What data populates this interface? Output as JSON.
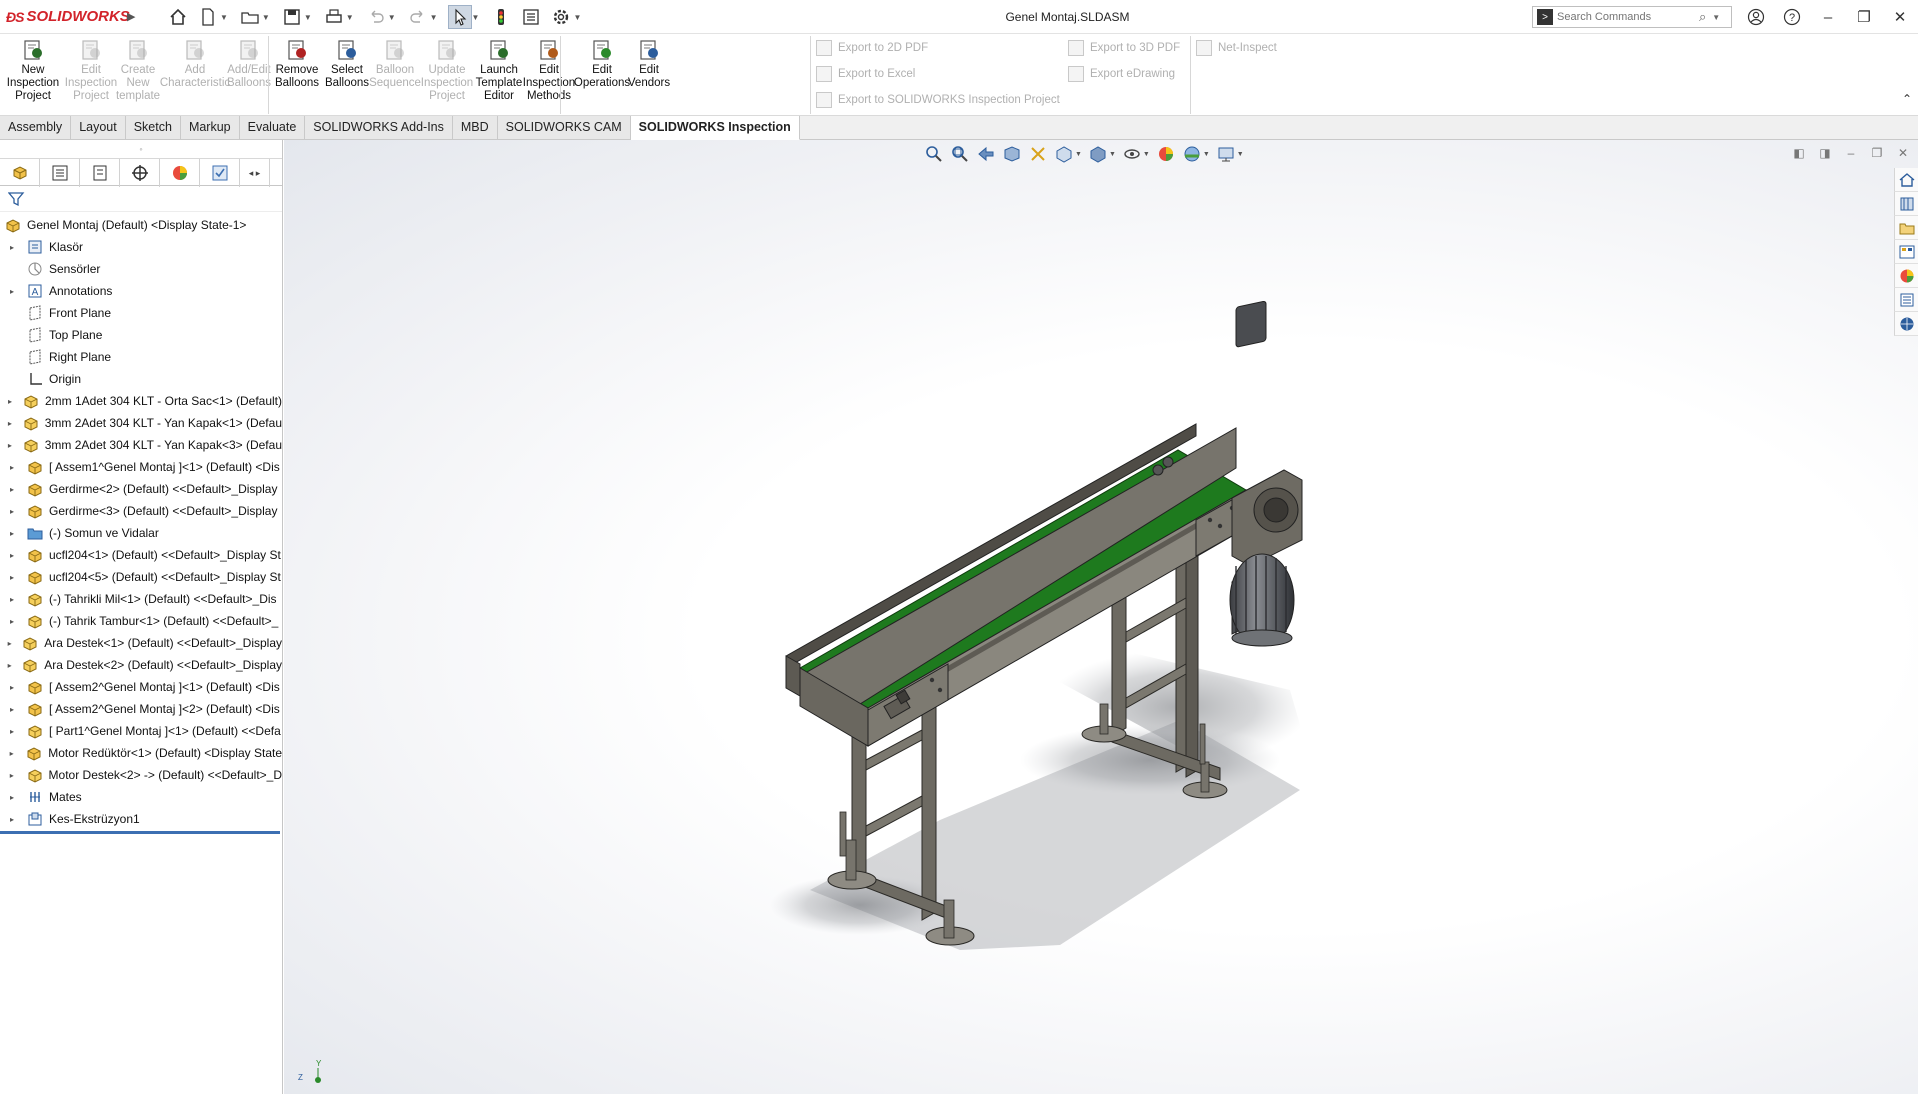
{
  "app": {
    "name": "SOLIDWORKS",
    "document_title": "Genel Montaj.SLDASM"
  },
  "search": {
    "placeholder": "Search Commands"
  },
  "ribbon": {
    "inspection_buttons": [
      {
        "label": "New\nInspection\nProject",
        "enabled": true,
        "icon": "new-inspection-project-icon"
      },
      {
        "label": "Edit\nInspection\nProject",
        "enabled": false,
        "icon": "edit-inspection-project-icon"
      },
      {
        "label": "Create\nNew\ntemplate",
        "enabled": false,
        "icon": "create-template-icon"
      },
      {
        "label": "Add\nCharacteristic",
        "enabled": false,
        "icon": "add-characteristic-icon"
      },
      {
        "label": "Add/Edit\nBalloons",
        "enabled": false,
        "icon": "add-edit-balloons-icon"
      },
      {
        "label": "Remove\nBalloons",
        "enabled": true,
        "icon": "remove-balloons-icon"
      },
      {
        "label": "Select\nBalloons",
        "enabled": true,
        "icon": "select-balloons-icon"
      },
      {
        "label": "Balloon\nSequence",
        "enabled": false,
        "icon": "balloon-sequence-icon"
      },
      {
        "label": "Update\nInspection\nProject",
        "enabled": false,
        "icon": "update-inspection-project-icon"
      },
      {
        "label": "Launch\nTemplate\nEditor",
        "enabled": true,
        "icon": "launch-template-editor-icon"
      },
      {
        "label": "Edit\nInspection\nMethods",
        "enabled": true,
        "icon": "edit-inspection-methods-icon"
      },
      {
        "label": "Edit\nOperations",
        "enabled": true,
        "icon": "edit-operations-icon"
      },
      {
        "label": "Edit\nVendors",
        "enabled": true,
        "icon": "edit-vendors-icon"
      }
    ],
    "export_items": [
      {
        "label": "Export to 2D PDF",
        "enabled": false
      },
      {
        "label": "Export to Excel",
        "enabled": false
      },
      {
        "label": "Export to SOLIDWORKS Inspection Project",
        "enabled": false
      },
      {
        "label": "Export to 3D PDF",
        "enabled": false
      },
      {
        "label": "Export eDrawing",
        "enabled": false
      },
      {
        "label": "Net-Inspect",
        "enabled": false
      }
    ]
  },
  "tabs": [
    {
      "label": "Assembly",
      "active": false
    },
    {
      "label": "Layout",
      "active": false
    },
    {
      "label": "Sketch",
      "active": false
    },
    {
      "label": "Markup",
      "active": false
    },
    {
      "label": "Evaluate",
      "active": false
    },
    {
      "label": "SOLIDWORKS Add-Ins",
      "active": false
    },
    {
      "label": "MBD",
      "active": false
    },
    {
      "label": "SOLIDWORKS CAM",
      "active": false
    },
    {
      "label": "SOLIDWORKS Inspection",
      "active": true
    }
  ],
  "tree": {
    "root": "Genel Montaj  (Default) <Display State-1>",
    "items": [
      {
        "label": "Klasör",
        "icon": "folder-history-icon",
        "expandable": true
      },
      {
        "label": "Sensörler",
        "icon": "sensor-icon",
        "expandable": false
      },
      {
        "label": "Annotations",
        "icon": "annotations-icon",
        "expandable": true
      },
      {
        "label": "Front Plane",
        "icon": "plane-icon",
        "expandable": false
      },
      {
        "label": "Top Plane",
        "icon": "plane-icon",
        "expandable": false
      },
      {
        "label": "Right Plane",
        "icon": "plane-icon",
        "expandable": false
      },
      {
        "label": "Origin",
        "icon": "origin-icon",
        "expandable": false
      },
      {
        "label": "2mm 1Adet 304 KLT - Orta Sac<1> (Default)",
        "icon": "part-icon",
        "expandable": true
      },
      {
        "label": "3mm 2Adet 304 KLT - Yan Kapak<1> (Defau",
        "icon": "part-icon",
        "expandable": true
      },
      {
        "label": "3mm 2Adet 304 KLT - Yan Kapak<3> (Defau",
        "icon": "part-icon",
        "expandable": true
      },
      {
        "label": "[ Assem1^Genel Montaj ]<1> (Default) <Dis",
        "icon": "assembly-icon",
        "expandable": true
      },
      {
        "label": "Gerdirme<2> (Default) <<Default>_Display",
        "icon": "assembly-icon",
        "expandable": true
      },
      {
        "label": "Gerdirme<3> (Default) <<Default>_Display",
        "icon": "assembly-icon",
        "expandable": true
      },
      {
        "label": "(-) Somun ve Vidalar",
        "icon": "folder-icon",
        "expandable": true
      },
      {
        "label": "ucfl204<1> (Default) <<Default>_Display St",
        "icon": "assembly-icon",
        "expandable": true
      },
      {
        "label": "ucfl204<5> (Default) <<Default>_Display St",
        "icon": "assembly-icon",
        "expandable": true
      },
      {
        "label": "(-) Tahrikli Mil<1> (Default) <<Default>_Dis",
        "icon": "part-icon",
        "expandable": true
      },
      {
        "label": "(-) Tahrik Tambur<1> (Default) <<Default>_",
        "icon": "part-icon",
        "expandable": true
      },
      {
        "label": "Ara Destek<1> (Default) <<Default>_Display",
        "icon": "part-icon",
        "expandable": true
      },
      {
        "label": "Ara Destek<2> (Default) <<Default>_Display",
        "icon": "part-icon",
        "expandable": true
      },
      {
        "label": "[ Assem2^Genel Montaj ]<1> (Default) <Dis",
        "icon": "assembly-icon",
        "expandable": true
      },
      {
        "label": "[ Assem2^Genel Montaj ]<2> (Default) <Dis",
        "icon": "assembly-icon",
        "expandable": true
      },
      {
        "label": "[ Part1^Genel Montaj ]<1> (Default) <<Defa",
        "icon": "part-icon",
        "expandable": true
      },
      {
        "label": "Motor Redüktör<1> (Default) <Display State",
        "icon": "assembly-icon",
        "expandable": true
      },
      {
        "label": "Motor Destek<2> -> (Default) <<Default>_D",
        "icon": "part-icon",
        "expandable": true
      },
      {
        "label": "Mates",
        "icon": "mates-icon",
        "expandable": true
      },
      {
        "label": "Kes-Ekstrüzyon1",
        "icon": "cut-extrude-icon",
        "expandable": true
      }
    ]
  },
  "triad": {
    "z": "Z",
    "y": "Y"
  },
  "colors": {
    "belt": "#1e7a1e",
    "frame": "#5b5850",
    "brand": "#d2232a",
    "accent": "#3c6fb2"
  }
}
